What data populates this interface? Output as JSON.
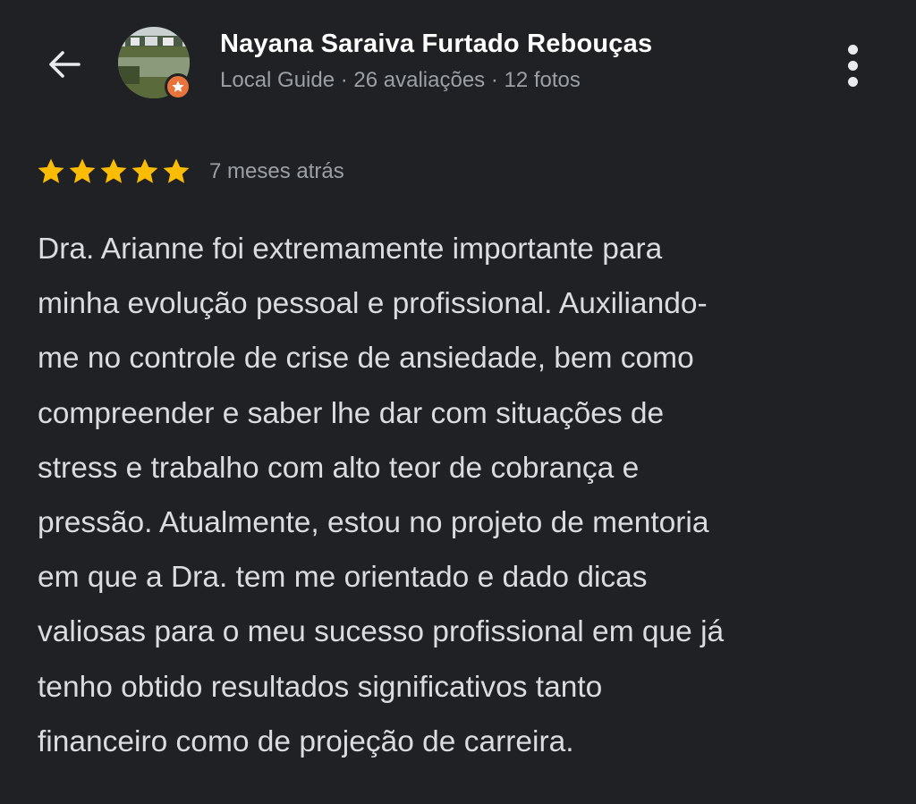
{
  "header": {
    "back_icon": "arrow-left-icon",
    "user_name": "Nayana Saraiva Furtado Rebouças",
    "user_meta": "Local Guide · 26 avaliações · 12 fotos",
    "badge_icon": "local-guide-star-icon",
    "more_icon": "more-vertical-icon"
  },
  "review": {
    "rating": 5,
    "max_rating": 5,
    "star_color": "#fbbc04",
    "date": "7 meses atrás",
    "lines": [
      "Dra. Arianne foi extremamente importante para",
      "minha evolução pessoal e profissional. Auxiliando-",
      "me no controle de crise de ansiedade, bem como",
      "compreender e saber lhe dar com situações de",
      "stress e trabalho com alto teor de cobrança e",
      "pressão. Atualmente, estou no projeto de mentoria",
      "em que a Dra. tem me orientado e dado dicas",
      "valiosas para o meu sucesso profissional em que já",
      "tenho obtido resultados significativos tanto",
      "financeiro como de projeção de carreira."
    ]
  },
  "colors": {
    "background": "#202124",
    "name": "#ffffff",
    "meta": "#9aa0a6",
    "body_text": "#dadce0",
    "badge": "#e8743b"
  }
}
